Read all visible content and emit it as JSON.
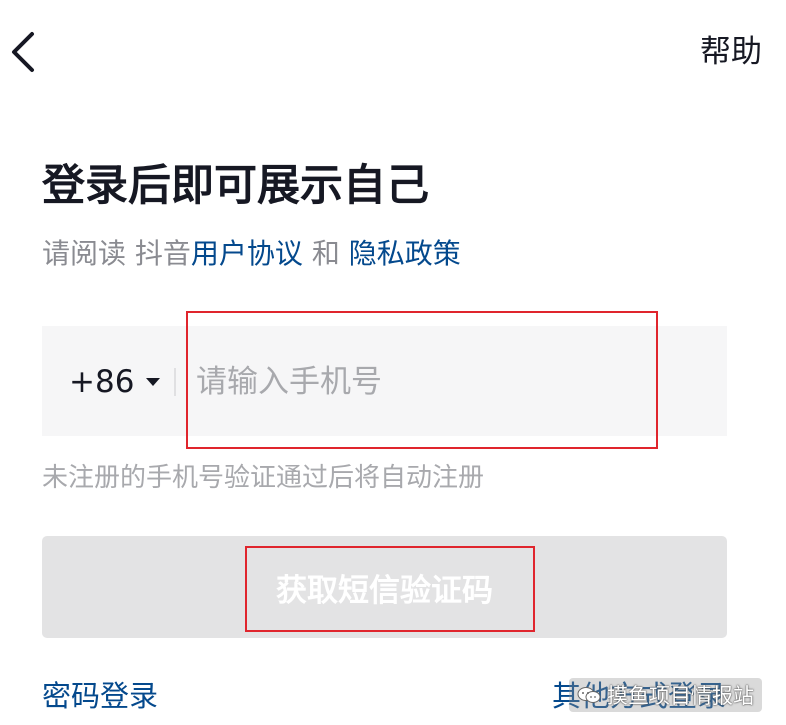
{
  "header": {
    "back_icon": "chevron-left-icon",
    "help_label": "帮助"
  },
  "title": "登录后即可展示自己",
  "agreement": {
    "prefix": "请阅读 抖音",
    "user_agreement": "用户协议",
    "and": " 和 ",
    "privacy_policy": "隐私政策"
  },
  "phone": {
    "country_code": "+86",
    "placeholder": "请输入手机号",
    "value": ""
  },
  "hint": "未注册的手机号验证通过后将自动注册",
  "sms_button_label": "获取短信验证码",
  "footer": {
    "password_login": "密码登录",
    "other_login": "其他方式登录"
  },
  "watermark": {
    "icon": "wechat-icon",
    "text": "摸鱼项目情报站"
  },
  "colors": {
    "link": "#04498d",
    "annotation": "#e0252d",
    "disabled_button": "#e3e3e4",
    "input_bg": "#f6f6f7"
  }
}
